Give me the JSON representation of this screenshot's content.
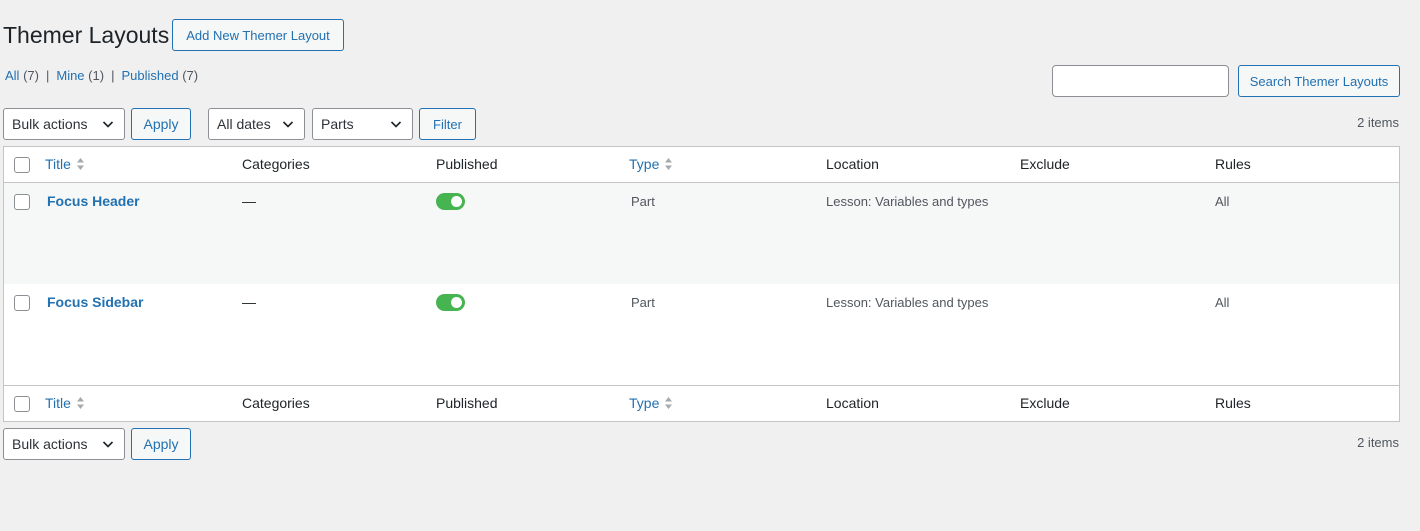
{
  "header": {
    "title": "Themer Layouts",
    "add_new_label": "Add New Themer Layout"
  },
  "views": [
    {
      "label": "All",
      "count": "(7)"
    },
    {
      "label": "Mine",
      "count": "(1)"
    },
    {
      "label": "Published",
      "count": "(7)"
    }
  ],
  "separator": "|",
  "search": {
    "value": "",
    "button_label": "Search Themer Layouts"
  },
  "tablenav_top": {
    "bulk_actions": "Bulk actions",
    "apply_label": "Apply",
    "dates_filter": "All dates",
    "type_filter": "Parts",
    "filter_label": "Filter",
    "items_count": "2 items"
  },
  "columns": [
    "Title",
    "Categories",
    "Published",
    "Type",
    "Location",
    "Exclude",
    "Rules"
  ],
  "rows": [
    {
      "title": "Focus Header",
      "categories": "—",
      "published": true,
      "type": "Part",
      "location": "Lesson: Variables and types",
      "exclude": "",
      "rules": "All"
    },
    {
      "title": "Focus Sidebar",
      "categories": "—",
      "published": true,
      "type": "Part",
      "location": "Lesson: Variables and types",
      "exclude": "",
      "rules": "All"
    }
  ],
  "tablenav_bottom": {
    "bulk_actions": "Bulk actions",
    "apply_label": "Apply",
    "items_count": "2 items"
  },
  "colors": {
    "accent": "#2271b1",
    "toggle_on": "#46b450",
    "background": "#f0f0f1"
  }
}
